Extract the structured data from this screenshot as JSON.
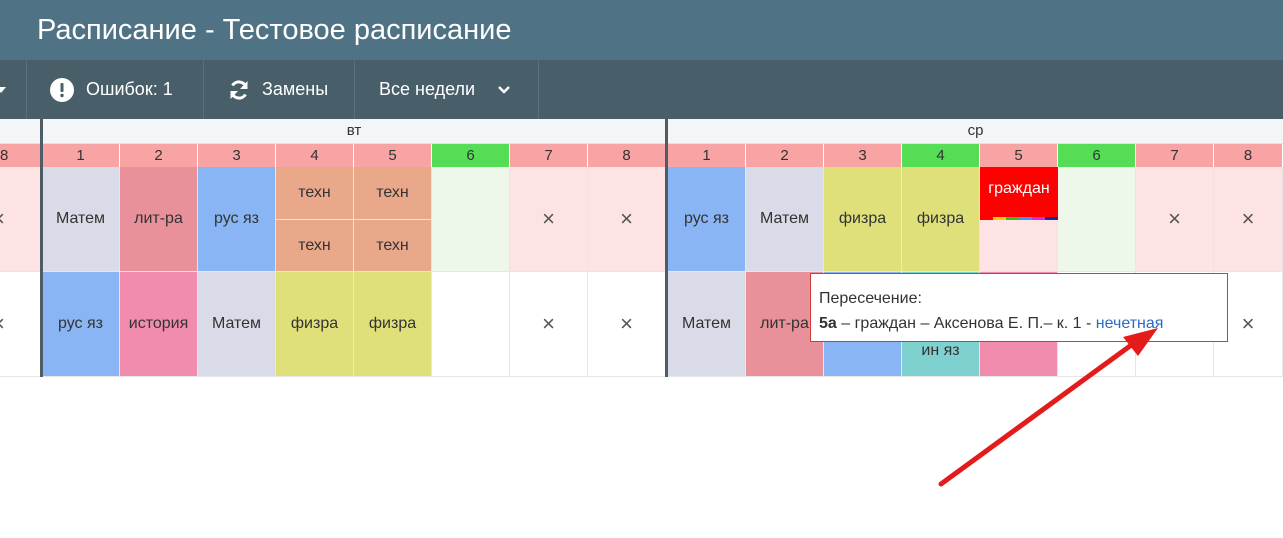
{
  "window": {
    "title": "Расписание - Тестовое расписание"
  },
  "toolbar": {
    "errors_label": "Ошибок: 1",
    "replacements_label": "Замены",
    "weeks_label": "Все недели"
  },
  "days": {
    "tue": "вт",
    "wed": "ср"
  },
  "periods": {
    "cut": "8",
    "tue": [
      "1",
      "2",
      "3",
      "4",
      "5",
      "6",
      "7",
      "8"
    ],
    "wed": [
      "1",
      "2",
      "3",
      "4",
      "5",
      "6",
      "7",
      "8"
    ]
  },
  "colors": {
    "period_default": "#f9a4a4",
    "period_free": "#55dd55",
    "matem": "#dadbe8",
    "litra": "#e8919b",
    "rusyaz": "#89b5f4",
    "tehn": "#e9a88a",
    "fizra": "#dfe07a",
    "istoriya": "#f28cae",
    "inyaz": "#7fd1d0",
    "conflict": "#ff0000",
    "row1_bg": "#fde3e4",
    "free_bg": "#eef8ea"
  },
  "row1": {
    "tue": {
      "p1": "Матем",
      "p2": "лит-ра",
      "p3": "рус яз",
      "p4a": "техн",
      "p4b": "техн",
      "p5a": "техн",
      "p5b": "техн"
    },
    "wed": {
      "p1": "рус яз",
      "p2": "Матем",
      "p3": "физра",
      "p4": "физра",
      "p5": "граждан"
    }
  },
  "row2": {
    "tue": {
      "p1": "рус яз",
      "p2": "история",
      "p3": "Матем",
      "p4": "физра",
      "p5": "физра"
    },
    "wed": {
      "p1": "Матем",
      "p2": "лит-ра",
      "p4": "ин яз"
    }
  },
  "empty_mark": "×",
  "tooltip": {
    "heading": "Пересечение:",
    "class_name": "5а",
    "details": " – граждан – Аксенова Е. П.– к. 1 - ",
    "parity_link": "нечетная"
  }
}
